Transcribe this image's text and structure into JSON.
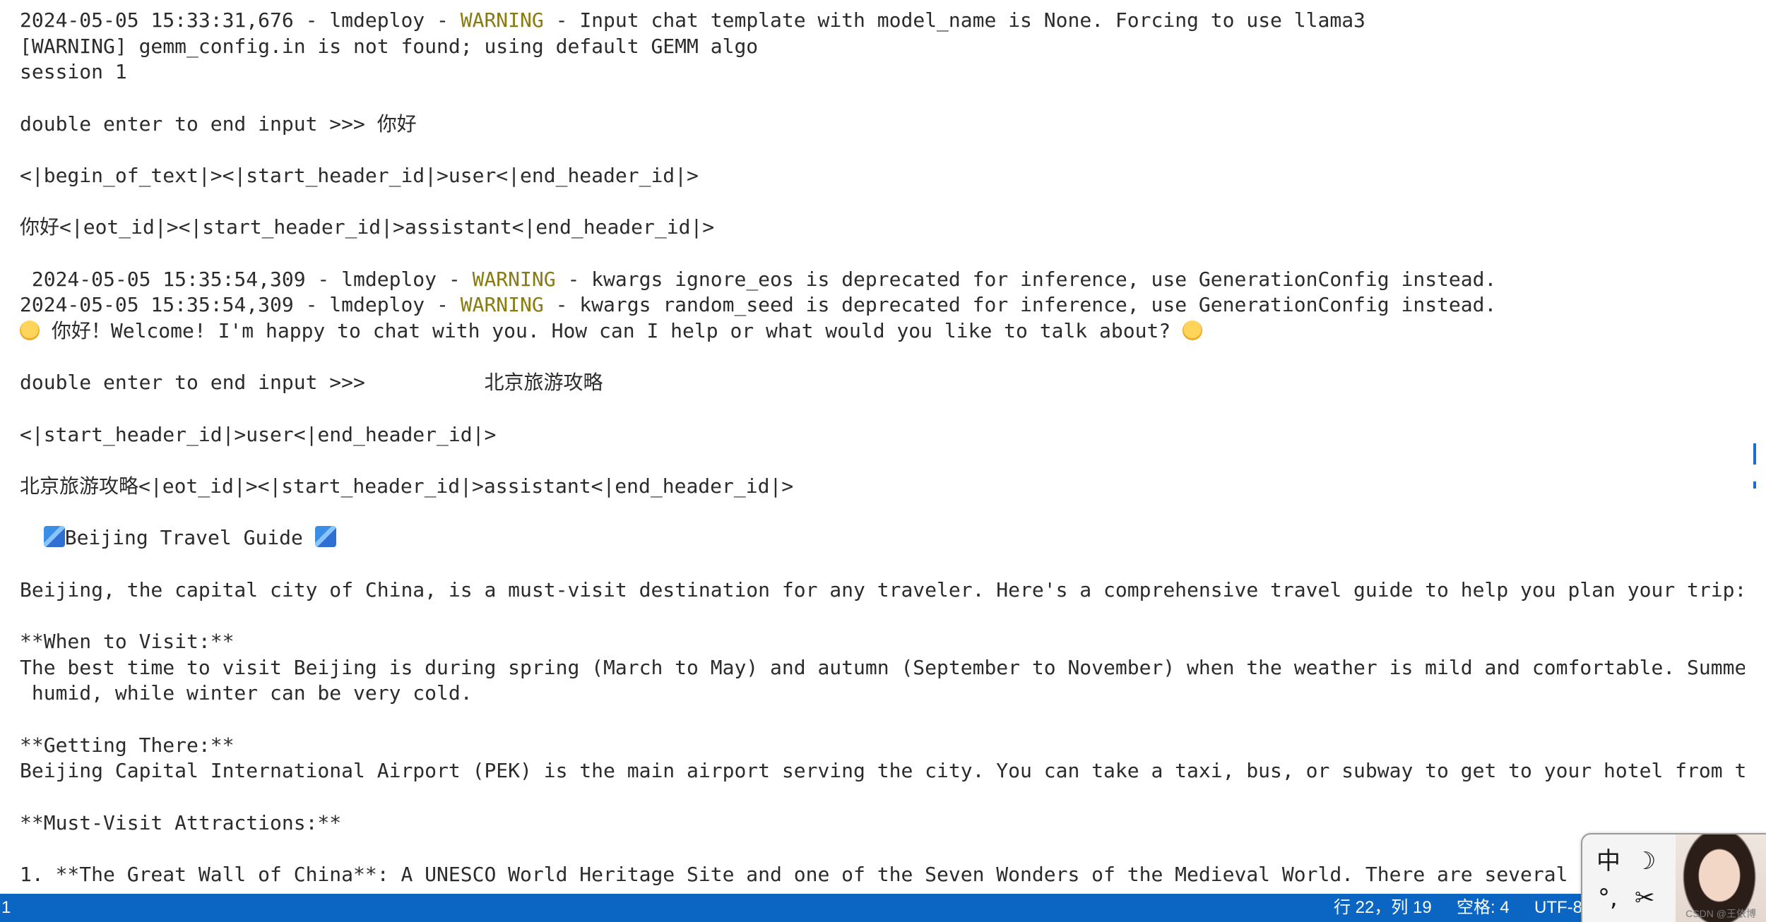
{
  "terminal": {
    "lines": [
      [
        {
          "t": "2024-05-05 15:33:31,676 - lmdeploy - "
        },
        {
          "t": "WARNING",
          "c": "warn"
        },
        {
          "t": " - Input chat template with model_name is None. Forcing to use llama3"
        }
      ],
      [
        {
          "t": "[WARNING] gemm_config.in is not found; using default GEMM algo"
        }
      ],
      [
        {
          "t": "session 1"
        }
      ],
      [],
      [
        {
          "t": "double enter to end input >>> 你好"
        }
      ],
      [],
      [
        {
          "t": "<|begin_of_text|><|start_header_id|>user<|end_header_id|>"
        }
      ],
      [],
      [
        {
          "t": "你好<|eot_id|><|start_header_id|>assistant<|end_header_id|>"
        }
      ],
      [],
      [
        {
          "t": " 2024-05-05 15:35:54,309 - lmdeploy - "
        },
        {
          "t": "WARNING",
          "c": "warn"
        },
        {
          "t": " - kwargs ignore_eos is deprecated for inference, use GenerationConfig instead."
        }
      ],
      [
        {
          "t": "2024-05-05 15:35:54,309 - lmdeploy - "
        },
        {
          "t": "WARNING",
          "c": "warn"
        },
        {
          "t": " - kwargs random_seed is deprecated for inference, use GenerationConfig instead."
        }
      ],
      [
        {
          "e": "smiling-face-emoji"
        },
        {
          "t": " 你好！Welcome! I'm happy to chat with you. How can I help or what would you like to talk about? "
        },
        {
          "e": "thinking-face-emoji"
        }
      ],
      [],
      [
        {
          "t": "double enter to end input >>>          北京旅游攻略"
        }
      ],
      [],
      [
        {
          "t": "<|start_header_id|>user<|end_header_id|>"
        }
      ],
      [],
      [
        {
          "t": "北京旅游攻略<|eot_id|><|start_header_id|>assistant<|end_header_id|>"
        }
      ],
      [],
      [
        {
          "t": "  "
        },
        {
          "e": "globe-emoji"
        },
        {
          "t": "Beijing Travel Guide "
        },
        {
          "e": "globe-emoji"
        }
      ],
      [],
      [
        {
          "t": "Beijing, the capital city of China, is a must-visit destination for any traveler. Here's a comprehensive travel guide to help you plan your trip:"
        }
      ],
      [],
      [
        {
          "t": "**When to Visit:**"
        }
      ],
      [
        {
          "t": "The best time to visit Beijing is during spring (March to May) and autumn (September to November) when the weather is mild and comfortable. Summer can be hot and"
        }
      ],
      [
        {
          "t": " humid, while winter can be very cold."
        }
      ],
      [],
      [
        {
          "t": "**Getting There:**"
        }
      ],
      [
        {
          "t": "Beijing Capital International Airport (PEK) is the main airport serving the city. You can take a taxi, bus, or subway to get to your hotel from the airport."
        }
      ],
      [],
      [
        {
          "t": "**Must-Visit Attractions:**"
        }
      ],
      [],
      [
        {
          "t": "1. **The Great Wall of China**: A UNESCO World Heritage Site and one of the Seven Wonders of the Medieval World. There are several sections to visit"
        }
      ]
    ]
  },
  "status_bar": {
    "left": "1",
    "position": "行 22，列 19",
    "spaces": "空格: 4",
    "encoding": "UTF-8"
  },
  "ime": {
    "lang": "中",
    "moon": "☽",
    "punct": "°,",
    "skin": "✂"
  },
  "watermark": "CSDN @王依博",
  "colors": {
    "status_bar": "#0a66c2",
    "warning": "#8a7a12",
    "background": "#ffffff"
  }
}
